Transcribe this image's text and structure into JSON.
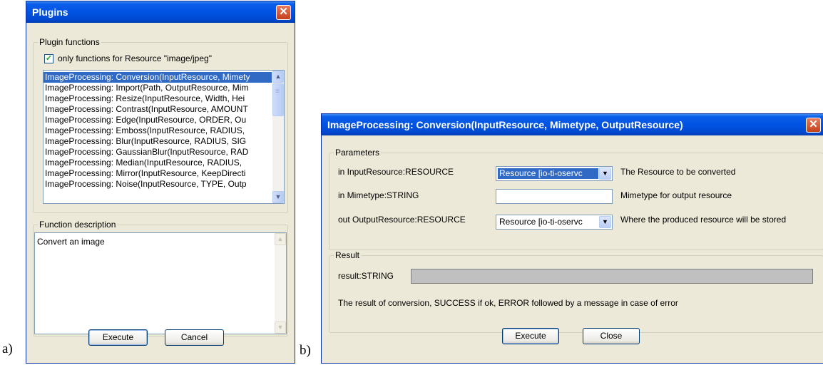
{
  "figure_labels": {
    "a": "a)",
    "b": "b)"
  },
  "plugins_dialog": {
    "title": "Plugins",
    "close_glyph": "✕",
    "functions_group": "Plugin functions",
    "filter_checkbox": {
      "checked": true,
      "label": "only functions for Resource \"image/jpeg\""
    },
    "functions": [
      "ImageProcessing: Conversion(InputResource, Mimety",
      "ImageProcessing: Import(Path, OutputResource, Mim",
      "ImageProcessing: Resize(InputResource, Width, Hei",
      "ImageProcessing: Contrast(InputResource, AMOUNT",
      "ImageProcessing: Edge(InputResource, ORDER, Ou",
      "ImageProcessing: Emboss(InputResource, RADIUS,",
      "ImageProcessing: Blur(InputResource, RADIUS, SIG",
      "ImageProcessing: GaussianBlur(InputResource, RAD",
      "ImageProcessing: Median(InputResource, RADIUS,",
      "ImageProcessing: Mirror(InputResource, KeepDirecti",
      "ImageProcessing: Noise(InputResource, TYPE, Outp"
    ],
    "selected_index": 0,
    "description_group": "Function description",
    "description_text": "Convert an image",
    "execute_label": "Execute",
    "cancel_label": "Cancel"
  },
  "conversion_dialog": {
    "title": "ImageProcessing: Conversion(InputResource, Mimetype, OutputResource)",
    "close_glyph": "✕",
    "parameters_group": "Parameters",
    "params": [
      {
        "label": "in InputResource:RESOURCE",
        "value": "Resource [io-ti-oservc",
        "description": "The Resource to be converted"
      },
      {
        "label": "in Mimetype:STRING",
        "value": "",
        "description": "Mimetype for output resource"
      },
      {
        "label": "out OutputResource:RESOURCE",
        "value": "Resource [io-ti-oservc",
        "description": "Where the produced resource will be stored"
      }
    ],
    "result_group": "Result",
    "result_label": "result:STRING",
    "result_value": "",
    "result_note": "The result of conversion, SUCCESS if ok, ERROR followed by a message in case of error",
    "execute_label": "Execute",
    "close_label": "Close"
  },
  "icons": {
    "scroll_up": "▲",
    "scroll_down": "▼",
    "combo_arrow": "▼",
    "check": "✓"
  }
}
